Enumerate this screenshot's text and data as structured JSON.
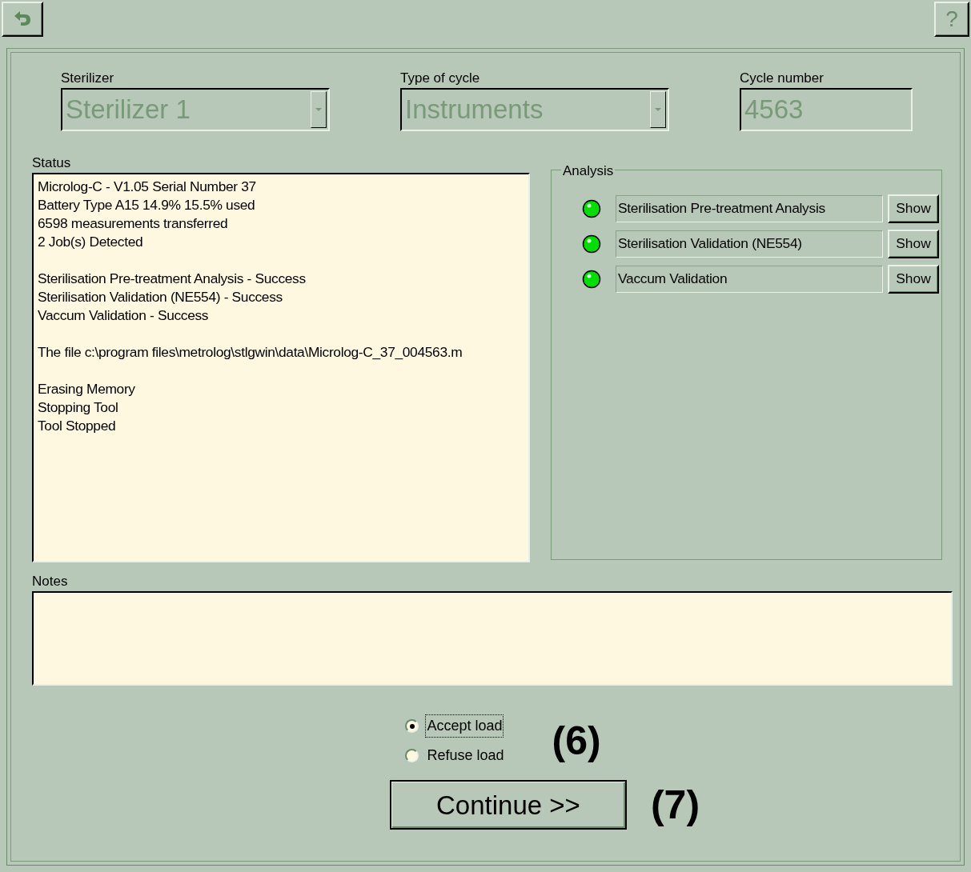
{
  "toolbar": {
    "help_button": "?"
  },
  "fields": [
    {
      "label": "Sterilizer",
      "kind": "combo",
      "value": "Sterilizer 1",
      "disabled": true
    },
    {
      "label": "Type of cycle",
      "kind": "combo",
      "value": "Instruments",
      "disabled": true
    },
    {
      "label": "Cycle number",
      "kind": "text",
      "value": "4563",
      "disabled": true
    }
  ],
  "status": {
    "label": "Status",
    "groups": [
      [
        "Microlog-C - V1.05 Serial Number 37",
        "Battery Type A15 14.9% 15.5% used",
        "6598 measurements transferred",
        "2 Job(s) Detected"
      ],
      [
        "Sterilisation Pre-treatment Analysis - Success",
        "Sterilisation Validation (NE554) - Success",
        "Vaccum Validation - Success"
      ],
      [
        "The file c:\\program files\\metrolog\\stlgwin\\data\\Microlog-C_37_004563.m"
      ],
      [
        "Erasing Memory",
        "Stopping Tool",
        "Tool Stopped"
      ]
    ]
  },
  "analysis": {
    "title": "Analysis",
    "items": [
      {
        "name": "Sterilisation Pre-treatment Analysis",
        "color": "#00e000",
        "button": "Show"
      },
      {
        "name": "Sterilisation Validation (NE554)",
        "color": "#00e000",
        "button": "Show"
      },
      {
        "name": "Vaccum Validation",
        "color": "#00e000",
        "button": "Show"
      }
    ]
  },
  "notes": {
    "label": "Notes"
  },
  "load_options": [
    {
      "label": "Accept load",
      "selected": true,
      "focused": true
    },
    {
      "label": "Refuse load",
      "selected": false,
      "focused": false
    }
  ],
  "continue_button": "Continue >>",
  "callouts": [
    "(6)",
    "(7)"
  ]
}
